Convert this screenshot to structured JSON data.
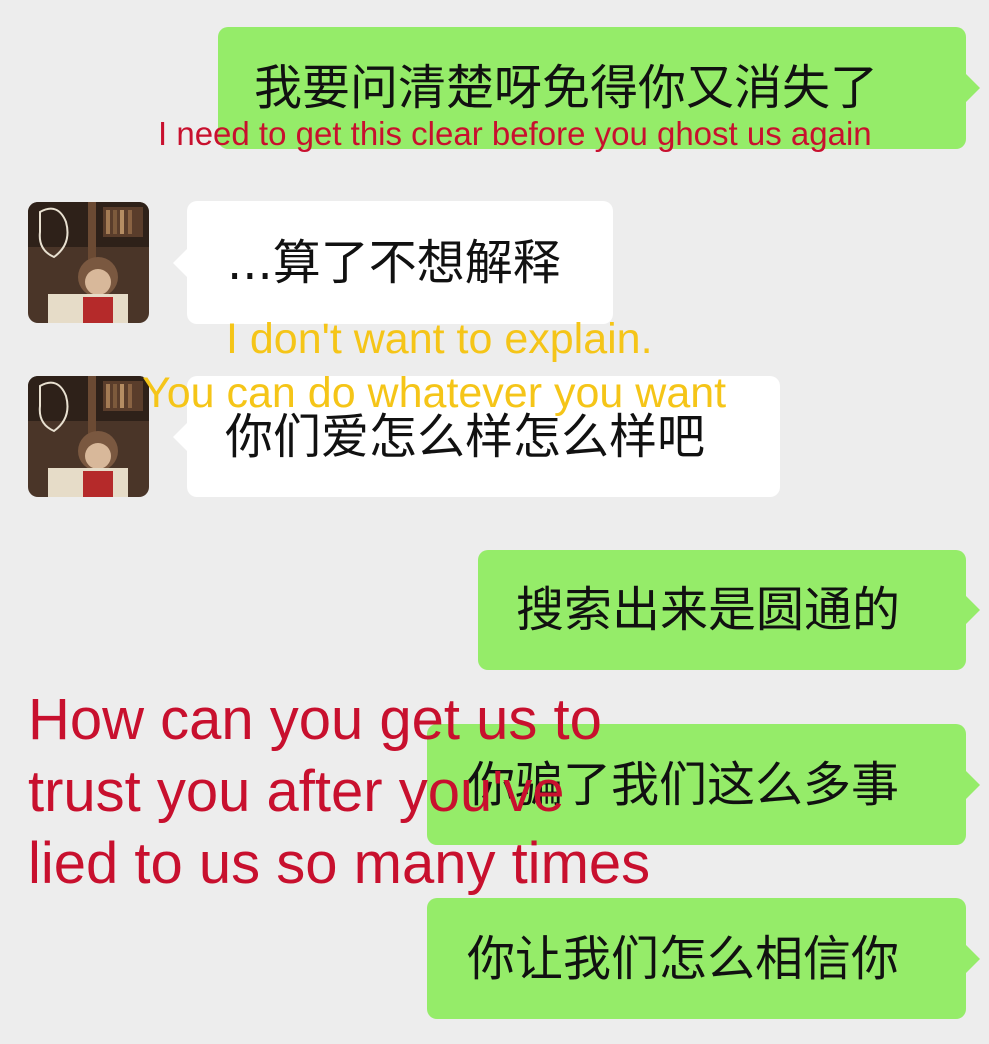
{
  "colors": {
    "background": "#ededed",
    "outgoing_bubble": "#95ec69",
    "incoming_bubble": "#ffffff",
    "caption_red": "#c8102e",
    "caption_yellow": "#f5c518"
  },
  "messages": [
    {
      "direction": "outgoing",
      "text": "我要问清楚呀免得你又消失了"
    },
    {
      "direction": "incoming",
      "text": "...算了不想解释"
    },
    {
      "direction": "incoming",
      "text": "你们爱怎么样怎么样吧"
    },
    {
      "direction": "outgoing",
      "text": "搜索出来是圆通的"
    },
    {
      "direction": "outgoing",
      "text": "你骗了我们这么多事"
    },
    {
      "direction": "outgoing",
      "text": "你让我们怎么相信你"
    }
  ],
  "captions": {
    "ghost": "I need to get this clear before you ghost us again",
    "explain_line1": "I don't want to explain.",
    "explain_line2": "You can do whatever you want",
    "trust_line1": "How can you get us to",
    "trust_line2": "trust you after you've",
    "trust_line3": "lied to us so many times"
  }
}
